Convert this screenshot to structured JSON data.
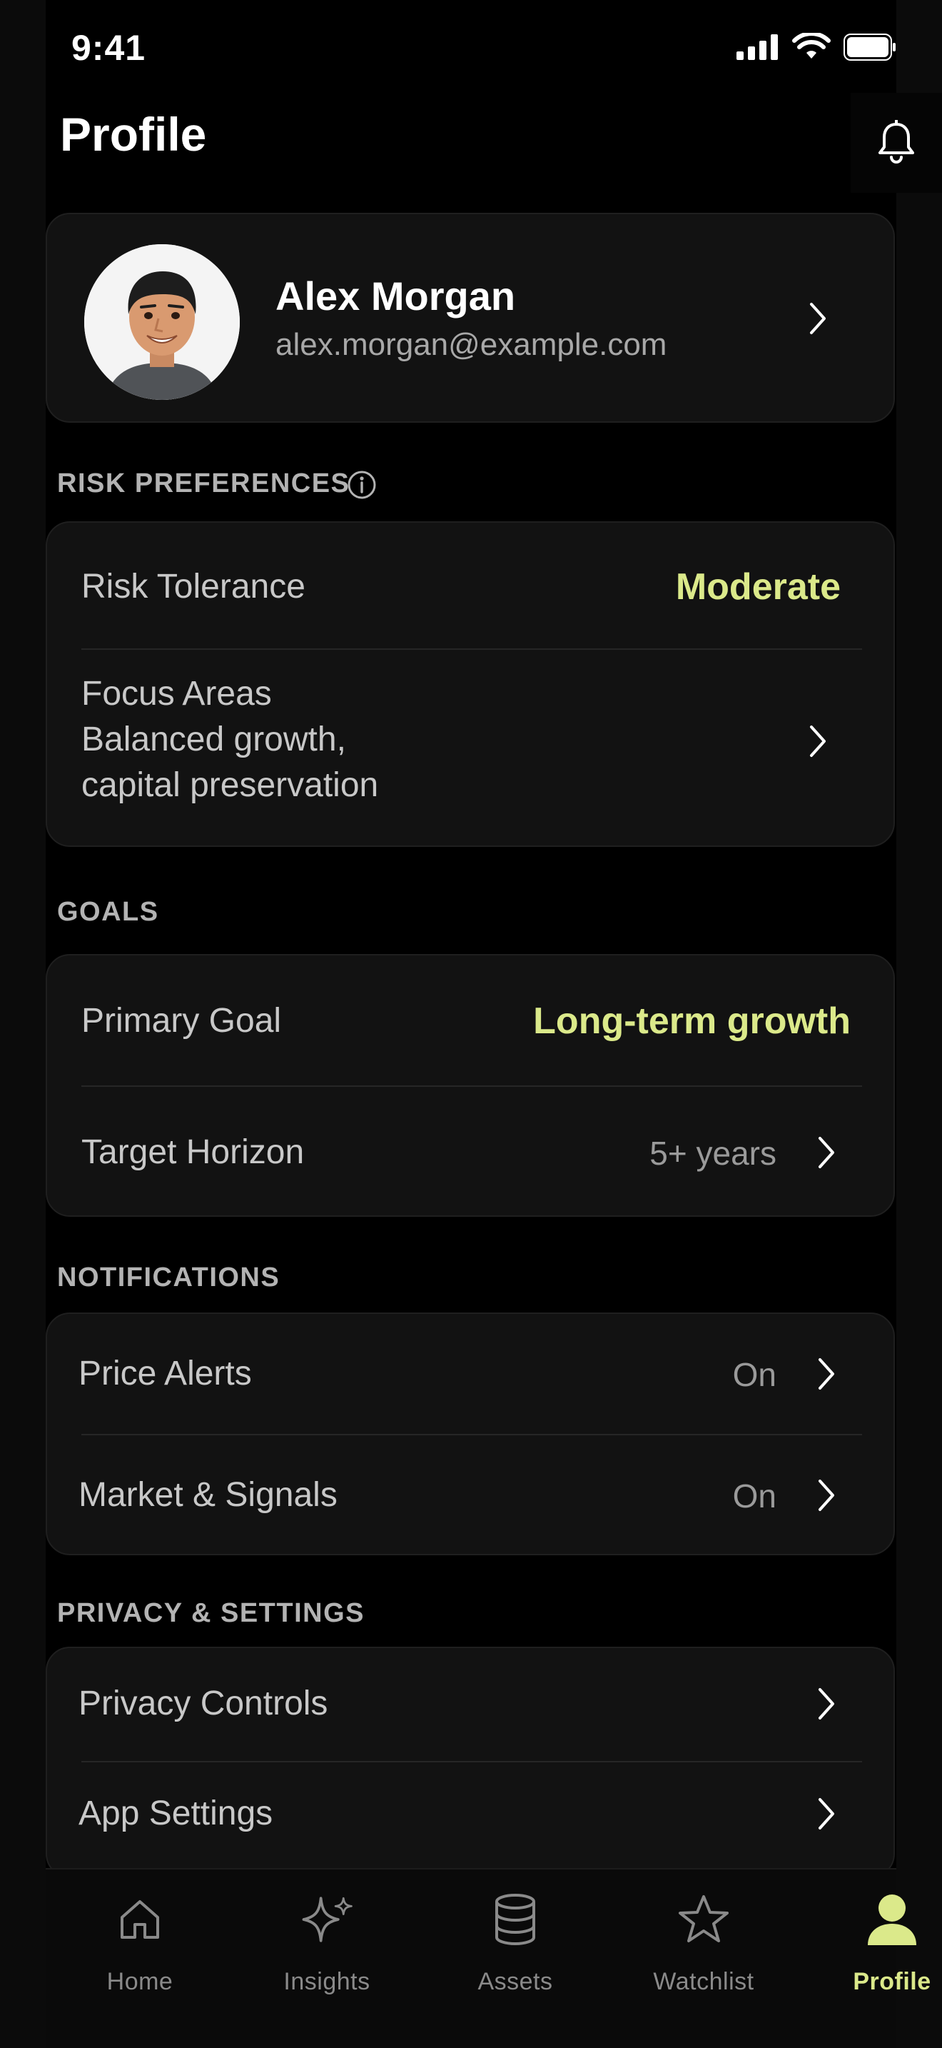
{
  "status_bar": {
    "time": "9:41"
  },
  "header": {
    "title": "Profile"
  },
  "profile": {
    "name": "Alex Morgan",
    "email": "alex.morgan@example.com"
  },
  "risk_preferences": {
    "section_label": "RISK PREFERENCES",
    "risk_tolerance_label": "Risk Tolerance",
    "risk_tolerance_value": "Moderate",
    "focus_areas_label": "Focus Areas",
    "focus_areas_line1": "Balanced growth,",
    "focus_areas_line2": "capital preservation"
  },
  "goals": {
    "section_label": "GOALS",
    "primary_goal_label": "Primary Goal",
    "primary_goal_value": "Long-term growth",
    "target_horizon_label": "Target Horizon",
    "target_horizon_value": "5+ years"
  },
  "notifications": {
    "section_label": "NOTIFICATIONS",
    "price_alerts_label": "Price Alerts",
    "price_alerts_value": "On",
    "market_signals_label": "Market & Signals",
    "market_signals_value": "On"
  },
  "privacy_settings": {
    "section_label": "PRIVACY & SETTINGS",
    "privacy_controls_label": "Privacy Controls",
    "app_settings_label": "App Settings"
  },
  "tab_bar": {
    "tabs": [
      {
        "label": "Home",
        "icon": "home-icon"
      },
      {
        "label": "Insights",
        "icon": "sparkle-icon"
      },
      {
        "label": "Assets",
        "icon": "database-icon"
      },
      {
        "label": "Watchlist",
        "icon": "star-icon"
      },
      {
        "label": "Profile",
        "icon": "person-icon"
      }
    ],
    "active_tab": "Profile"
  },
  "colors": {
    "accent": "#dbe98a",
    "background": "#000000",
    "card": "#121212"
  }
}
